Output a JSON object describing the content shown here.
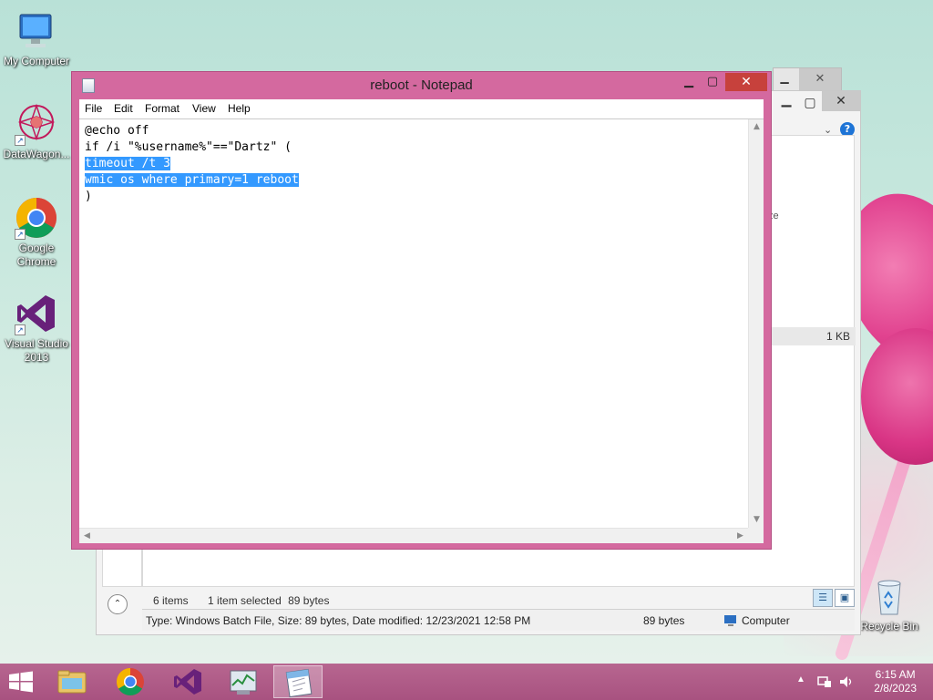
{
  "desktop": {
    "icons": [
      {
        "label": "My Computer"
      },
      {
        "label": "DataWagon..."
      },
      {
        "label": "Google\nChrome"
      },
      {
        "label": "Visual Studio\n2013"
      },
      {
        "label": "Recycle Bin"
      }
    ]
  },
  "notepad": {
    "title": "reboot - Notepad",
    "menu": [
      "File",
      "Edit",
      "Format",
      "View",
      "Help"
    ],
    "lines": [
      "@echo off",
      "if /i \"%username%\"==\"Dartz\" (",
      "timeout /t 3",
      "wmic os where primary=1 reboot",
      ")"
    ],
    "selected_lines": [
      2,
      3
    ]
  },
  "explorer": {
    "column_partial": "ze",
    "file_size": "1 KB",
    "status": {
      "items": "6 items",
      "selected": "1 item selected",
      "selected_size": "89 bytes"
    },
    "details_bar": {
      "info": "Type: Windows Batch File, Size: 89 bytes, Date modified: 12/23/2021 12:58 PM",
      "size": "89 bytes",
      "location": "Computer"
    }
  },
  "taskbar": {
    "clock_time": "6:15 AM",
    "clock_date": "2/8/2023"
  },
  "colors": {
    "notepad_frame": "#d4699f",
    "selection": "#3399ff",
    "taskbar": "#b05d88",
    "close_button": "#c7413c"
  }
}
